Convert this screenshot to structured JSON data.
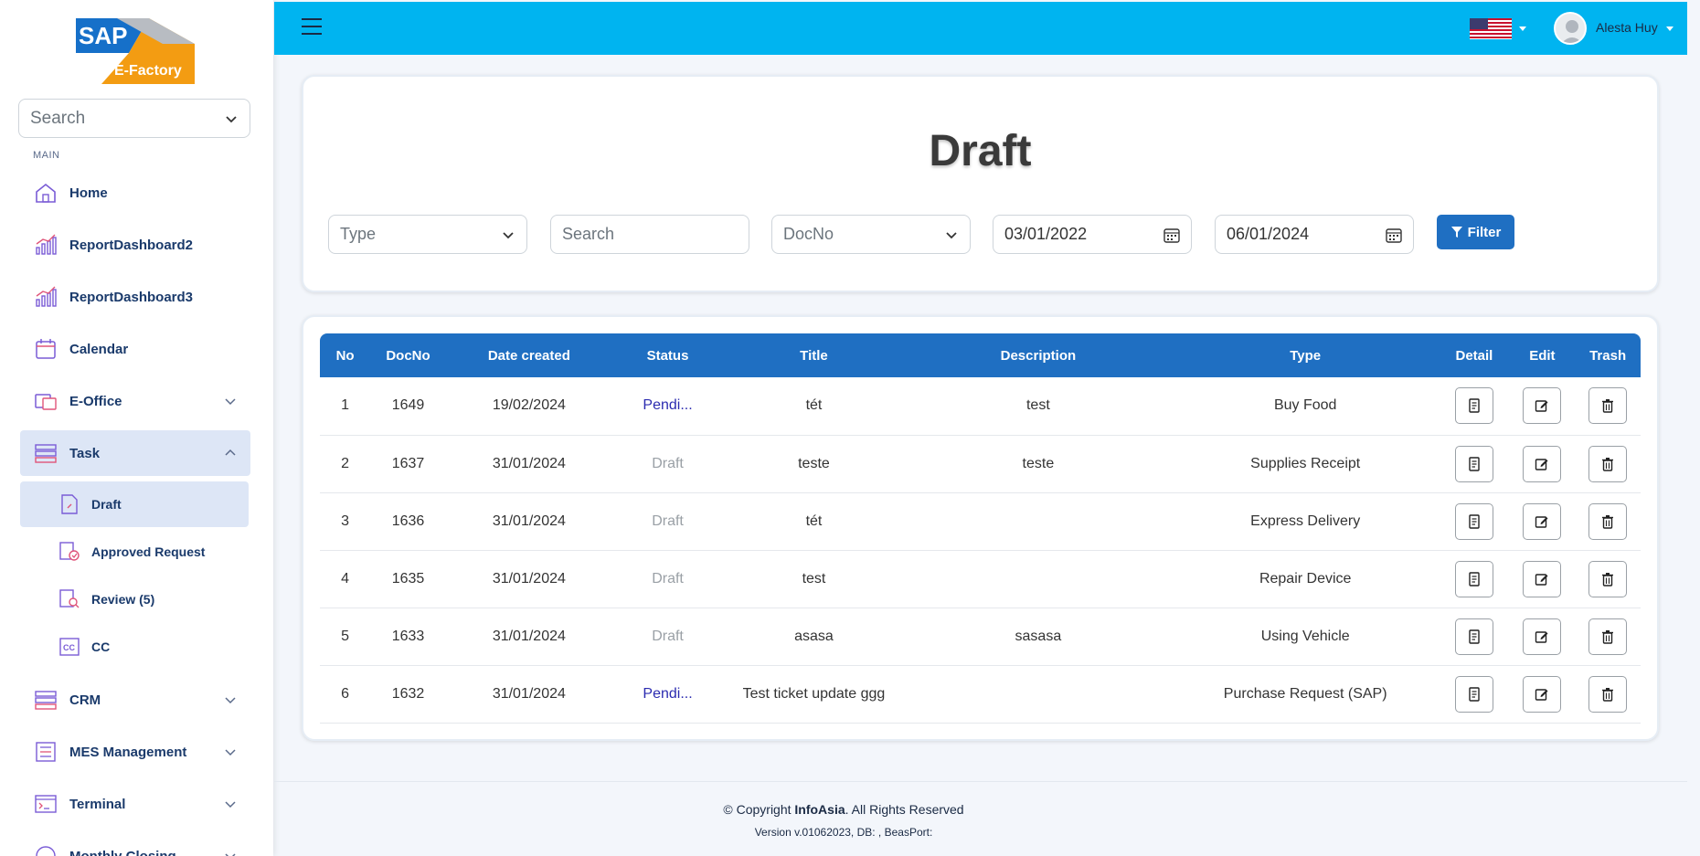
{
  "sidebar": {
    "logo": {
      "top": "SAP",
      "bottom": "E-Factory"
    },
    "search_placeholder": "Search",
    "section_label": "MAIN",
    "items": [
      {
        "label": "Home",
        "icon": "home-icon"
      },
      {
        "label": "ReportDashboard2",
        "icon": "chart-icon"
      },
      {
        "label": "ReportDashboard3",
        "icon": "chart-icon"
      },
      {
        "label": "Calendar",
        "icon": "calendar-icon"
      },
      {
        "label": "E-Office",
        "icon": "office-icon"
      },
      {
        "label": "Task",
        "icon": "task-icon"
      },
      {
        "label": "CRM",
        "icon": "crm-icon"
      },
      {
        "label": "MES Management",
        "icon": "mes-icon"
      },
      {
        "label": "Terminal",
        "icon": "terminal-icon"
      },
      {
        "label": "Monthly Closing",
        "icon": "closing-icon"
      }
    ],
    "task_sub": [
      {
        "label": "Draft",
        "icon": "draft-icon"
      },
      {
        "label": "Approved Request",
        "icon": "approved-icon"
      },
      {
        "label": "Review (5)",
        "icon": "review-icon"
      },
      {
        "label": "CC",
        "icon": "cc-icon"
      }
    ]
  },
  "topbar": {
    "username": "Alesta Huy",
    "language": "en-US"
  },
  "filter": {
    "title": "Draft",
    "type_placeholder": "Type",
    "search_placeholder": "Search",
    "docno_placeholder": "DocNo",
    "from_date": "03/01/2022",
    "to_date": "06/01/2024",
    "filter_label": "Filter"
  },
  "table": {
    "headers": [
      "No",
      "DocNo",
      "Date created",
      "Status",
      "Title",
      "Description",
      "Type",
      "Detail",
      "Edit",
      "Trash"
    ],
    "rows": [
      {
        "no": "1",
        "docno": "1649",
        "date": "19/02/2024",
        "status": "Pendi...",
        "status_kind": "pending",
        "title": "tét",
        "description": "test",
        "type": "Buy Food"
      },
      {
        "no": "2",
        "docno": "1637",
        "date": "31/01/2024",
        "status": "Draft",
        "status_kind": "draft",
        "title": "teste",
        "description": "teste",
        "type": "Supplies Receipt"
      },
      {
        "no": "3",
        "docno": "1636",
        "date": "31/01/2024",
        "status": "Draft",
        "status_kind": "draft",
        "title": "tét",
        "description": "",
        "type": "Express Delivery"
      },
      {
        "no": "4",
        "docno": "1635",
        "date": "31/01/2024",
        "status": "Draft",
        "status_kind": "draft",
        "title": "test",
        "description": "",
        "type": "Repair Device"
      },
      {
        "no": "5",
        "docno": "1633",
        "date": "31/01/2024",
        "status": "Draft",
        "status_kind": "draft",
        "title": "asasa",
        "description": "sasasa",
        "type": "Using Vehicle"
      },
      {
        "no": "6",
        "docno": "1632",
        "date": "31/01/2024",
        "status": "Pendi...",
        "status_kind": "pending",
        "title": "Test ticket update ggg",
        "description": "",
        "type": "Purchase Request (SAP)"
      }
    ]
  },
  "footer": {
    "copyright_prefix": "© Copyright ",
    "company": "InfoAsia",
    "copyright_suffix": ". All Rights Reserved",
    "version": "Version v.01062023, DB: , BeasPort:"
  },
  "colors": {
    "topbar": "#00b4f0",
    "primary": "#1f6fc2",
    "nav_text": "#1a3a6b",
    "active_bg": "#dde6f6"
  }
}
